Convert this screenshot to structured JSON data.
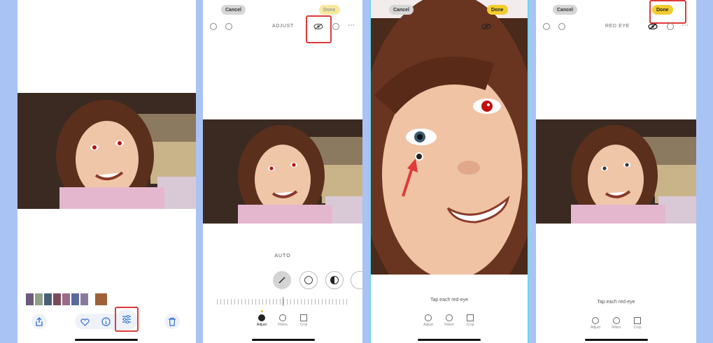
{
  "colors": {
    "accent_red": "#e03a3a",
    "done_yellow": "#f2cd2e",
    "icon_blue": "#2f6fd8",
    "page_bg": "#a9c3f5"
  },
  "panel2": {
    "cancel": "Cancel",
    "done": "Done",
    "mode": "ADJUST",
    "auto_label": "AUTO",
    "tabs": [
      "Adjust",
      "Filters",
      "Crop"
    ]
  },
  "panel3": {
    "cancel": "Cancel",
    "done": "Done",
    "hint": "Tap each red-eye",
    "tabs": [
      "Adjust",
      "Filters",
      "Crop"
    ]
  },
  "panel4": {
    "cancel": "Cancel",
    "done": "Done",
    "mode": "RED EYE",
    "hint": "Tap each red-eye",
    "tabs": [
      "Adjust",
      "Filters",
      "Crop"
    ]
  },
  "icons": {
    "share": "share-icon",
    "favorite": "heart-icon",
    "info": "info-icon",
    "edit": "sliders-icon",
    "delete": "trash-icon",
    "red_eye": "eye-slash-icon"
  }
}
